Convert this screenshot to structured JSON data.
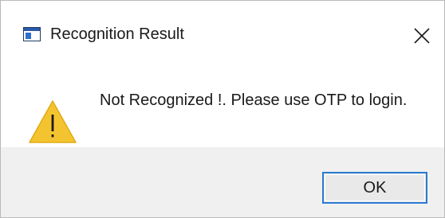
{
  "window": {
    "title": "Recognition Result",
    "app_icon": "window-app-icon",
    "close_icon": "close-icon"
  },
  "content": {
    "icon": "warning-icon",
    "message": "Not Recognized !. Please use OTP to login."
  },
  "footer": {
    "ok_label": "OK"
  },
  "colors": {
    "warning_fill": "#f4c430",
    "warning_mark": "#1a1a1a",
    "button_border": "#2a7bd0",
    "footer_bg": "#f0f0f0"
  }
}
